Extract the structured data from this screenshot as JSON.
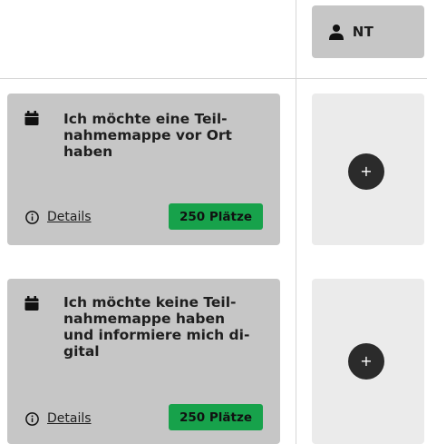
{
  "header": {
    "user_chip": {
      "icon": "user-icon",
      "label": "NT"
    }
  },
  "options": [
    {
      "icon": "calendar-icon",
      "title": "Ich möchte eine Teil-\nnahmemappe vor Ort\nhaben",
      "details_icon": "info-icon",
      "details_label": "Details",
      "seats_label": "250 Plätze",
      "seats_color": "#17a24b",
      "add_icon": "plus-icon",
      "add_label": "+"
    },
    {
      "icon": "calendar-icon",
      "title": "Ich möchte keine Teil-\nnahmemappe haben\nund informiere mich di-\ngital",
      "details_icon": "info-icon",
      "details_label": "Details",
      "seats_label": "250 Plätze",
      "seats_color": "#17a24b",
      "add_icon": "plus-icon",
      "add_label": "+"
    }
  ],
  "colors": {
    "card_bg": "#c6c6c6",
    "slot_bg": "#ebebeb",
    "add_button_bg": "#2b2b2b",
    "text": "#1e1e1e"
  }
}
